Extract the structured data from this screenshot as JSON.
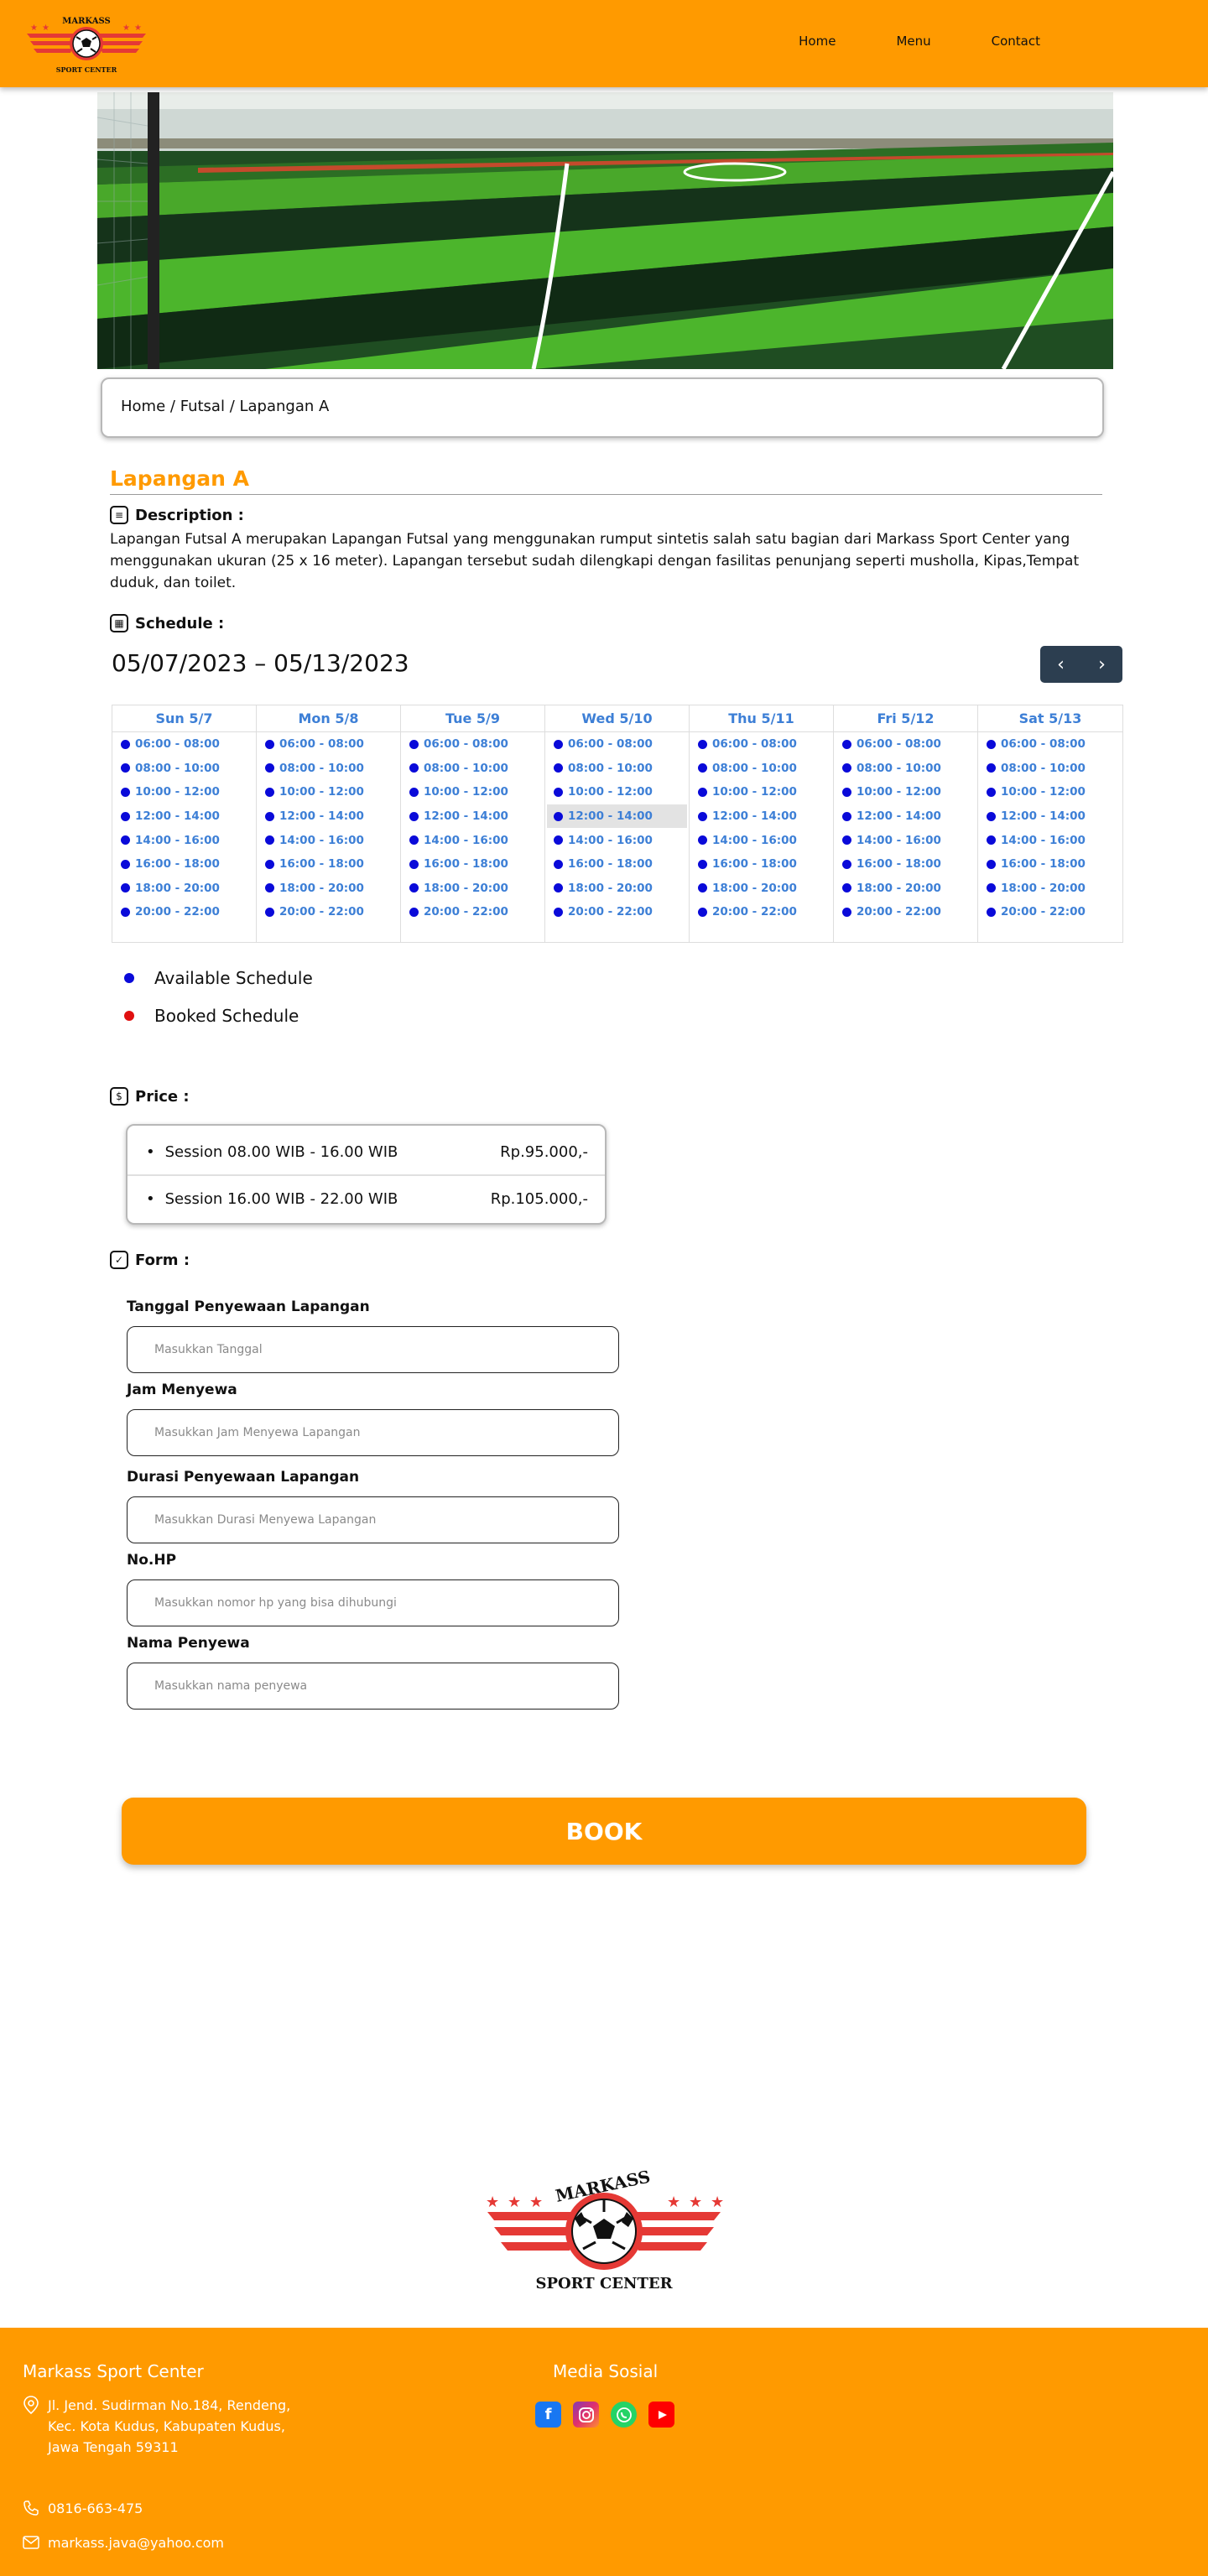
{
  "brand": {
    "logo_top": "MARKASS",
    "logo_bottom": "SPORT CENTER"
  },
  "nav": {
    "items": [
      "Home",
      "Menu",
      "Contact"
    ]
  },
  "breadcrumb": {
    "home": "Home",
    "sep1": "/",
    "category": "Futsal",
    "sep2": "/",
    "current": "Lapangan A"
  },
  "field": {
    "title": "Lapangan A",
    "description_label": "Description :",
    "description": "Lapangan Futsal A merupakan Lapangan Futsal yang menggunakan rumput sintetis salah satu bagian dari Markass Sport Center yang menggunakan ukuran (25 x 16 meter). Lapangan tersebut sudah dilengkapi dengan fasilitas penunjang seperti musholla, Kipas,Tempat duduk, dan toilet."
  },
  "schedule": {
    "label": "Schedule :",
    "week_range": "05/07/2023 – 05/13/2023",
    "prev_icon": "chevron-left-icon",
    "next_icon": "chevron-right-icon",
    "days": [
      {
        "label": "Sun 5/7",
        "slots": [
          "06:00 - 08:00",
          "08:00 - 10:00",
          "10:00 - 12:00",
          "12:00 - 14:00",
          "14:00 - 16:00",
          "16:00 - 18:00",
          "18:00 - 20:00",
          "20:00 - 22:00"
        ]
      },
      {
        "label": "Mon 5/8",
        "slots": [
          "06:00 - 08:00",
          "08:00 - 10:00",
          "10:00 - 12:00",
          "12:00 - 14:00",
          "14:00 - 16:00",
          "16:00 - 18:00",
          "18:00 - 20:00",
          "20:00 - 22:00"
        ]
      },
      {
        "label": "Tue 5/9",
        "slots": [
          "06:00 - 08:00",
          "08:00 - 10:00",
          "10:00 - 12:00",
          "12:00 - 14:00",
          "14:00 - 16:00",
          "16:00 - 18:00",
          "18:00 - 20:00",
          "20:00 - 22:00"
        ]
      },
      {
        "label": "Wed 5/10",
        "slots": [
          "06:00 - 08:00",
          "08:00 - 10:00",
          "10:00 - 12:00",
          "12:00 - 14:00",
          "14:00 - 16:00",
          "16:00 - 18:00",
          "18:00 - 20:00",
          "20:00 - 22:00"
        ],
        "highlight_index": 3
      },
      {
        "label": "Thu 5/11",
        "slots": [
          "06:00 - 08:00",
          "08:00 - 10:00",
          "10:00 - 12:00",
          "12:00 - 14:00",
          "14:00 - 16:00",
          "16:00 - 18:00",
          "18:00 - 20:00",
          "20:00 - 22:00"
        ]
      },
      {
        "label": "Fri 5/12",
        "slots": [
          "06:00 - 08:00",
          "08:00 - 10:00",
          "10:00 - 12:00",
          "12:00 - 14:00",
          "14:00 - 16:00",
          "16:00 - 18:00",
          "18:00 - 20:00",
          "20:00 - 22:00"
        ]
      },
      {
        "label": "Sat 5/13",
        "slots": [
          "06:00 - 08:00",
          "08:00 - 10:00",
          "10:00 - 12:00",
          "12:00 - 14:00",
          "14:00 - 16:00",
          "16:00 - 18:00",
          "18:00 - 20:00",
          "20:00 - 22:00"
        ]
      }
    ],
    "legend": {
      "available": "Available Schedule",
      "available_color": "#0a0ad9",
      "booked": "Booked Schedule",
      "booked_color": "#e01010"
    }
  },
  "price": {
    "label": "Price :",
    "rows": [
      {
        "session": "Session 08.00 WIB - 16.00 WIB",
        "amount": "Rp.95.000,-"
      },
      {
        "session": "Session 16.00 WIB - 22.00 WIB",
        "amount": "Rp.105.000,-"
      }
    ]
  },
  "form": {
    "label": "Form :",
    "fields": [
      {
        "label": "Tanggal Penyewaan Lapangan",
        "placeholder": "Masukkan Tanggal",
        "value": ""
      },
      {
        "label": "Jam Menyewa",
        "placeholder": "Masukkan Jam Menyewa Lapangan",
        "value": ""
      },
      {
        "label": "Durasi Penyewaan Lapangan",
        "placeholder": "Masukkan Durasi Menyewa Lapangan",
        "value": ""
      },
      {
        "label": "No.HP",
        "placeholder": "Masukkan nomor hp yang bisa dihubungi",
        "value": ""
      },
      {
        "label": "Nama Penyewa",
        "placeholder": "Masukkan nama penyewa",
        "value": ""
      }
    ],
    "submit": "BOOK"
  },
  "footer": {
    "brand": "Markass Sport Center",
    "address": "Jl. Jend. Sudirman No.184, Rendeng, Kec. Kota Kudus, Kabupaten Kudus, Jawa Tengah 59311",
    "phone": "0816-663-475",
    "email": "markass.java@yahoo.com",
    "social_title": "Media Sosial",
    "social": [
      "facebook-icon",
      "instagram-icon",
      "whatsapp-icon",
      "youtube-icon"
    ]
  },
  "colors": {
    "accent": "#ff9a00",
    "slot_text": "#3d7fd6",
    "nav_button": "#2c3e50"
  }
}
